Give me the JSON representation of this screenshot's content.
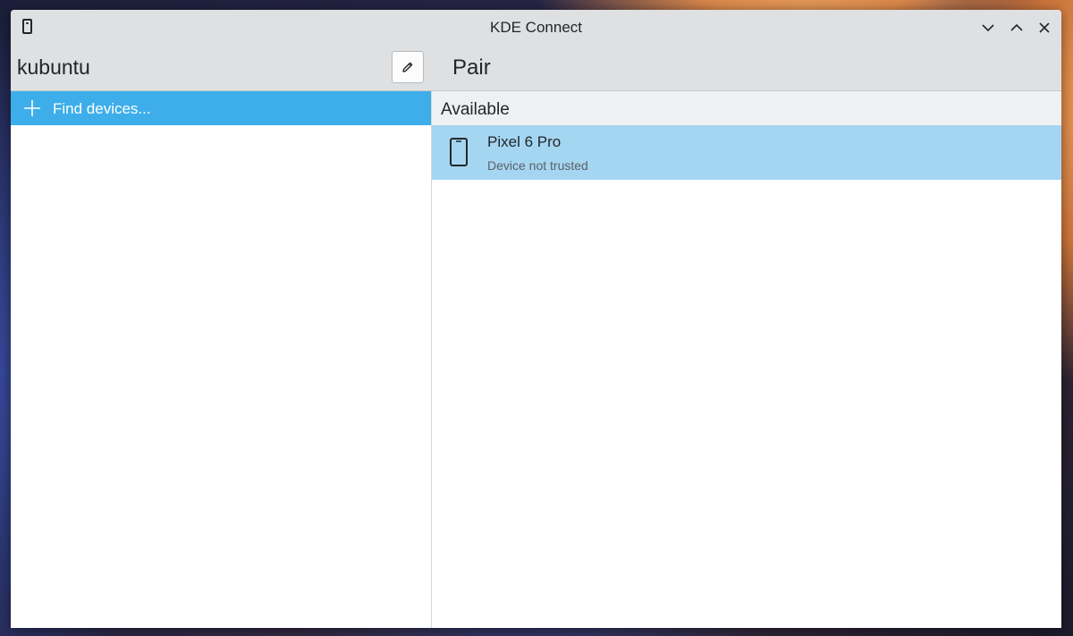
{
  "window": {
    "title": "KDE Connect",
    "app_icon": "phone-icon",
    "controls": [
      "minimize-icon",
      "maximize-icon",
      "close-icon"
    ]
  },
  "header": {
    "device_name": "kubuntu",
    "rename_icon": "pencil-icon",
    "page_title": "Pair"
  },
  "sidebar": {
    "items": [
      {
        "label": "Find devices...",
        "icon": "plus-icon",
        "selected": true
      }
    ]
  },
  "main": {
    "section_label": "Available",
    "devices": [
      {
        "name": "Pixel 6 Pro",
        "status": "Device not trusted",
        "icon": "phone-icon",
        "selected": true
      }
    ]
  },
  "colors": {
    "accent": "#3daee9",
    "selection_light": "#a4d6f2",
    "titlebar": "#dee0e2",
    "text": "#232629"
  }
}
